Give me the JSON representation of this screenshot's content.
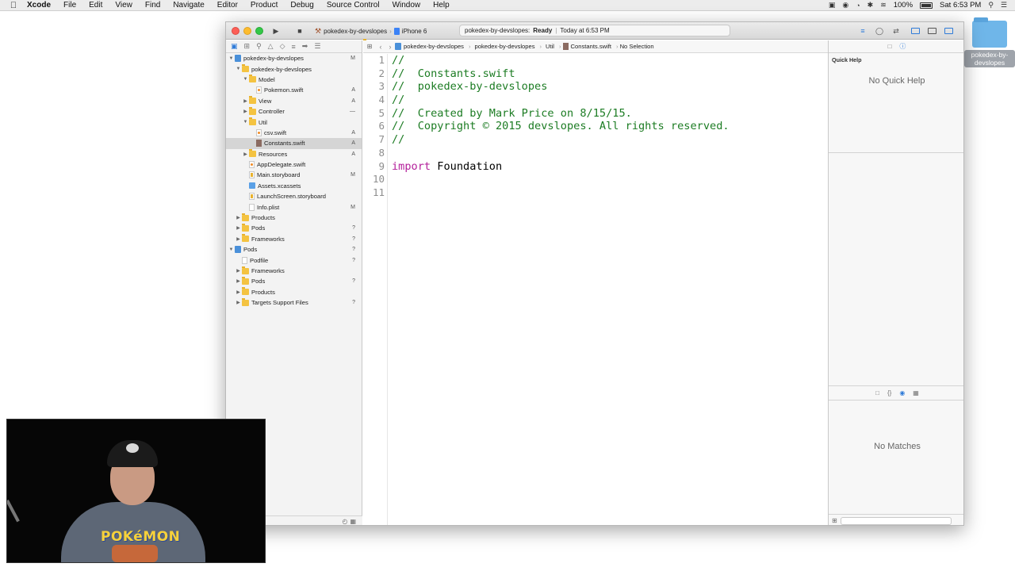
{
  "menubar": {
    "app": "Xcode",
    "items": [
      "File",
      "Edit",
      "View",
      "Find",
      "Navigate",
      "Editor",
      "Product",
      "Debug",
      "Source Control",
      "Window",
      "Help"
    ],
    "battery": "100%",
    "clock": "Sat 6:53 PM"
  },
  "desktop": {
    "folder_label": "pokedex-by-devslopes"
  },
  "toolbar": {
    "scheme": "pokedex-by-devslopes",
    "device": "iPhone 6",
    "activity_project": "pokedex-by-devslopes:",
    "activity_status": "Ready",
    "activity_time": "Today at 6:53 PM"
  },
  "navigator": {
    "rows": [
      {
        "label": "pokedex-by-devslopes",
        "badge": "M"
      },
      {
        "label": "pokedex-by-devslopes",
        "badge": ""
      },
      {
        "label": "Model",
        "badge": ""
      },
      {
        "label": "Pokemon.swift",
        "badge": "A"
      },
      {
        "label": "View",
        "badge": "A"
      },
      {
        "label": "Controller",
        "badge": "—"
      },
      {
        "label": "Util",
        "badge": ""
      },
      {
        "label": "csv.swift",
        "badge": "A"
      },
      {
        "label": "Constants.swift",
        "badge": "A"
      },
      {
        "label": "Resources",
        "badge": "A"
      },
      {
        "label": "AppDelegate.swift",
        "badge": ""
      },
      {
        "label": "Main.storyboard",
        "badge": "M"
      },
      {
        "label": "Assets.xcassets",
        "badge": ""
      },
      {
        "label": "LaunchScreen.storyboard",
        "badge": ""
      },
      {
        "label": "Info.plist",
        "badge": "M"
      },
      {
        "label": "Products",
        "badge": ""
      },
      {
        "label": "Pods",
        "badge": "?"
      },
      {
        "label": "Frameworks",
        "badge": "?"
      },
      {
        "label": "Pods",
        "badge": "?"
      },
      {
        "label": "Podfile",
        "badge": "?"
      },
      {
        "label": "Frameworks",
        "badge": ""
      },
      {
        "label": "Pods",
        "badge": "?"
      },
      {
        "label": "Products",
        "badge": ""
      },
      {
        "label": "Targets Support Files",
        "badge": "?"
      }
    ]
  },
  "jumpbar": {
    "crumbs": [
      "pokedex-by-devslopes",
      "pokedex-by-devslopes",
      "Util",
      "Constants.swift",
      "No Selection"
    ]
  },
  "editor": {
    "line_numbers": [
      "1",
      "2",
      "3",
      "4",
      "5",
      "6",
      "7",
      "8",
      "9",
      "10",
      "11"
    ],
    "lines": {
      "l1": "//",
      "l2": "//  Constants.swift",
      "l3": "//  pokedex-by-devslopes",
      "l4": "//",
      "l5": "//  Created by Mark Price on 8/15/15.",
      "l6": "//  Copyright © 2015 devslopes. All rights reserved.",
      "l7": "//",
      "l9_keyword": "import",
      "l9_rest": " Foundation"
    }
  },
  "utilities": {
    "quick_help_title": "Quick Help",
    "quick_help_empty": "No Quick Help",
    "library_empty": "No Matches"
  },
  "webcam": {
    "shirt_text": "POKéMON"
  },
  "colors": {
    "comment": "#1c7c23",
    "keyword": "#b4219b",
    "accent": "#2f7bd8"
  }
}
